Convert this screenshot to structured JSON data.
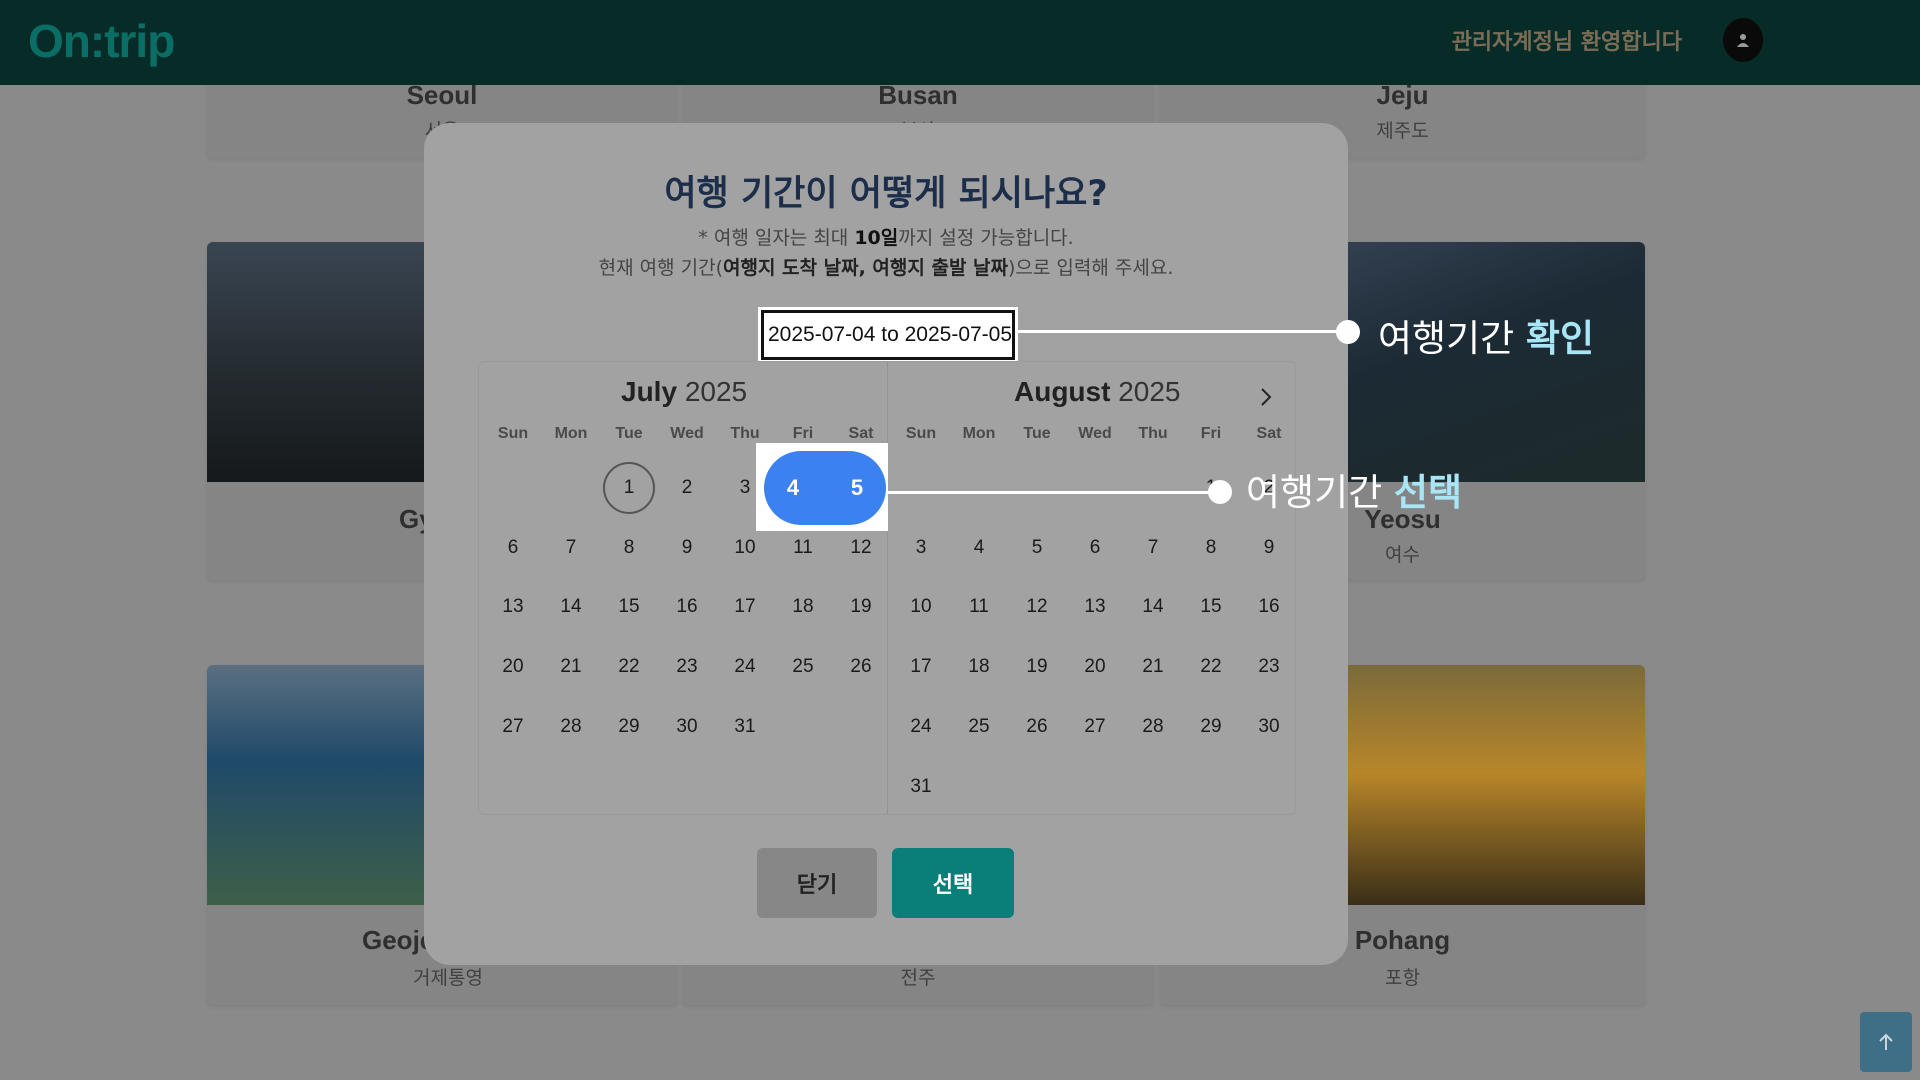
{
  "header": {
    "logo": "On:trip",
    "welcome": "관리자계정님 환영합니다"
  },
  "cards": [
    {
      "name": "Seoul",
      "sub": "서울"
    },
    {
      "name": "Busan",
      "sub": "부산"
    },
    {
      "name": "Jeju",
      "sub": "제주도"
    },
    {
      "name": "Gy",
      "sub": ""
    },
    {
      "name": "Yeosu",
      "sub": "여수"
    },
    {
      "name": "Geoje",
      "sub": "거제통영"
    },
    {
      "name": "",
      "sub": "전주"
    },
    {
      "name": "Pohang",
      "sub": "포항"
    }
  ],
  "modal": {
    "title": "여행 기간이 어떻게 되시나요?",
    "note1_prefix": "* 여행 일자는 최대 ",
    "note1_bold": "10일",
    "note1_suffix": "까지 설정 가능합니다.",
    "note2_prefix": "현재 여행 기간(",
    "note2_bold": "여행지 도착 날짜, 여행지 출발 날짜",
    "note2_suffix": ")으로 입력해 주세요.",
    "date_value": "2025-07-04 to 2025-07-05",
    "close_label": "닫기",
    "select_label": "선택"
  },
  "calendar": {
    "weekdays": [
      "Sun",
      "Mon",
      "Tue",
      "Wed",
      "Thu",
      "Fri",
      "Sat"
    ],
    "months": [
      {
        "name": "July",
        "year": "2025",
        "first_weekday": 2,
        "days": 31
      },
      {
        "name": "August",
        "year": "2025",
        "first_weekday": 5,
        "days": 31
      }
    ],
    "today": "2025-07-01",
    "selected_start": "4",
    "selected_end": "5"
  },
  "annotations": {
    "confirm_prefix": "여행기간 ",
    "confirm_highlight": "확인",
    "select_prefix": "여행기간 ",
    "select_highlight": "선택"
  },
  "colors": {
    "header": "#072c28",
    "accent": "#0a7f7a",
    "selection": "#3b82f0",
    "annotation_highlight": "#a8e6f5"
  }
}
